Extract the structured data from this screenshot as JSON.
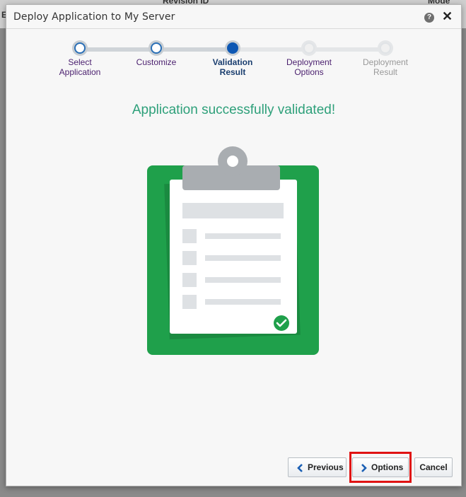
{
  "background": {
    "fragment_1": "Revision ID",
    "fragment_2": "Mode",
    "fragment_3": "E"
  },
  "dialog": {
    "title": "Deploy Application to My Server",
    "help_glyph": "?",
    "close_glyph": "✕"
  },
  "train": {
    "steps": [
      {
        "label_1": "Select",
        "label_2": "Application",
        "state": "visited"
      },
      {
        "label_1": "Customize",
        "label_2": "",
        "state": "visited"
      },
      {
        "label_1": "Validation",
        "label_2": "Result",
        "state": "current"
      },
      {
        "label_1": "Deployment",
        "label_2": "Options",
        "state": "visited"
      },
      {
        "label_1": "Deployment",
        "label_2": "Result",
        "state": "unvisited"
      }
    ]
  },
  "message": "Application successfully validated!",
  "footer": {
    "previous_label": "Previous",
    "options_label": "Options",
    "cancel_label": "Cancel"
  },
  "colors": {
    "success_text": "#2ea07a",
    "clipboard_green": "#1fa04b",
    "current_step": "#0d57b3",
    "highlight": "#e01313"
  },
  "icons": [
    "help-icon",
    "close-icon",
    "clipboard-illustration",
    "check-circle-icon",
    "chevron-left-icon",
    "chevron-right-icon"
  ]
}
